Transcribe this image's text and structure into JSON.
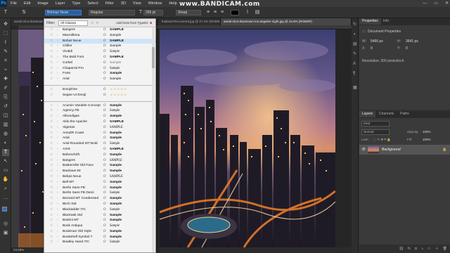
{
  "app": {
    "logo": "Ps"
  },
  "watermark": "www.BANDICAM.com",
  "menu": [
    "File",
    "Edit",
    "Image",
    "Layer",
    "Type",
    "Select",
    "Filter",
    "3D",
    "View",
    "Window",
    "Help"
  ],
  "window_controls": [
    "—",
    "▭",
    "✕"
  ],
  "options": {
    "font_family": "Bohnaz Neue",
    "font_style": "Regular",
    "font_size": "256 pt",
    "antialias": "Sharp"
  },
  "tabs": [
    {
      "label": "aerial-shot-downtown-los-angeles-night..."
    },
    {
      "label": "thailand-Recovered.jpg @ 27.2% (RGB/8...)"
    },
    {
      "label": "aerial-shot-downtown-los-angeles-night.jpg @ 24.6% (RGB/8#)"
    }
  ],
  "status": {
    "zoom": "24.59%"
  },
  "font_panel": {
    "filter_label": "Filter:",
    "classes": "All Classes",
    "add_fonts": "Add fonts from Typekit:",
    "top_fonts": [
      {
        "name": "Bangers",
        "sample": "SAMPLE"
      },
      {
        "name": "Macmillena",
        "sample": "Sample"
      },
      {
        "name": "Bohaz Neue",
        "sample": "SAMPLE",
        "selected": true
      },
      {
        "name": "Chiller",
        "sample": "Sample"
      },
      {
        "name": "Vivaldi",
        "sample": "Sample"
      },
      {
        "name": "The Bold Font",
        "sample": "SAMPLE"
      },
      {
        "name": "Corbel",
        "sample": "Sample"
      },
      {
        "name": "Chaparral Pro",
        "sample": "Sample"
      },
      {
        "name": "Forte",
        "sample": "Sample"
      },
      {
        "name": "Arial",
        "sample": "Sample"
      }
    ],
    "emoji_fonts": [
      {
        "name": "EmojiOne",
        "sample": "☺☺☺☺☺"
      },
      {
        "name": "Segoe UI Emoji",
        "sample": "☺☺☺☺☺"
      }
    ],
    "all_fonts": [
      {
        "name": "Acumin Variable Concept",
        "sample": "Sample"
      },
      {
        "name": "Agency FB",
        "sample": "Sample"
      },
      {
        "name": "Albondigas",
        "sample": "Sample"
      },
      {
        "name": "Aldo the Apache",
        "sample": "SAMPLE"
      },
      {
        "name": "Algerian",
        "sample": "SAMPLE"
      },
      {
        "name": "AmaZR Coast",
        "sample": "Sample"
      },
      {
        "name": "Arial",
        "sample": "Sample"
      },
      {
        "name": "Arial Rounded MT Bold",
        "sample": "Sample"
      },
      {
        "name": "AXIS",
        "sample": "SAMPLE"
      },
      {
        "name": "Bahnschrift",
        "sample": "Sample"
      },
      {
        "name": "Bangers",
        "sample": "SAMPLE"
      },
      {
        "name": "Baskerville Old Face",
        "sample": "Sample"
      },
      {
        "name": "Bauhaus 93",
        "sample": "Sample"
      },
      {
        "name": "Bebas Neue",
        "sample": "SAMPLE"
      },
      {
        "name": "Bell MT",
        "sample": "Sample"
      },
      {
        "name": "Berlin Sans FB",
        "sample": "Sample"
      },
      {
        "name": "Berlin Sans FB Demi",
        "sample": "Sample"
      },
      {
        "name": "Bernard MT Condensed",
        "sample": "Sample"
      },
      {
        "name": "Birch Std",
        "sample": "Sample"
      },
      {
        "name": "Blackadder ITC",
        "sample": "Sample"
      },
      {
        "name": "Blackoak Std",
        "sample": "Sample"
      },
      {
        "name": "Bodoni MT",
        "sample": "Sample"
      },
      {
        "name": "Book Antiqua",
        "sample": "Sample"
      },
      {
        "name": "Bookman Old Style",
        "sample": "Sample"
      },
      {
        "name": "Bookshelf Symbol 7",
        "sample": "Sample"
      },
      {
        "name": "Bradley Hand ITC",
        "sample": "Sample"
      }
    ]
  },
  "properties": {
    "tabs": [
      "Properties",
      "Info"
    ],
    "doc_label": "Document Properties",
    "w_label": "W:",
    "w_value": "5466 px",
    "h_label": "H:",
    "h_value": "3641 px",
    "x_label": "X:",
    "x_value": "0",
    "y_label": "Y:",
    "y_value": "0",
    "resolution": "Resolution: 300 pixels/inch"
  },
  "layers": {
    "tabs": [
      "Layers",
      "Channels",
      "Paths"
    ],
    "kind": "Kind",
    "blend": "Normal",
    "opacity_label": "Opacity:",
    "opacity": "100%",
    "lock_label": "Lock:",
    "fill_label": "Fill:",
    "fill": "100%",
    "background_layer": "Background"
  }
}
